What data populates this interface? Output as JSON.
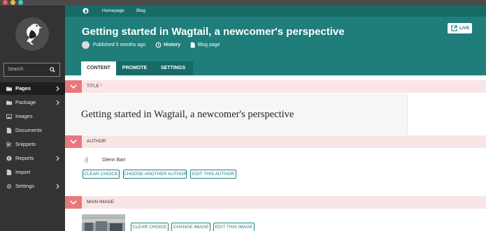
{
  "window": {
    "dots": [
      "#f25a5a",
      "#f5b640",
      "#3ec8c0"
    ]
  },
  "sidebar": {
    "search_placeholder": "Search",
    "items": [
      {
        "label": "Pages",
        "icon": "folder-icon",
        "active": true,
        "chevron": true
      },
      {
        "label": "Package",
        "icon": "package-icon",
        "active": false,
        "chevron": true
      },
      {
        "label": "Images",
        "icon": "image-icon",
        "active": false,
        "chevron": false
      },
      {
        "label": "Documents",
        "icon": "document-icon",
        "active": false,
        "chevron": false
      },
      {
        "label": "Snippets",
        "icon": "snippet-icon",
        "active": false,
        "chevron": false
      },
      {
        "label": "Reports",
        "icon": "report-icon",
        "active": false,
        "chevron": true
      },
      {
        "label": "Import",
        "icon": "import-icon",
        "active": false,
        "chevron": false
      },
      {
        "label": "Settings",
        "icon": "cog-icon",
        "active": false,
        "chevron": true
      }
    ]
  },
  "header": {
    "breadcrumb": [
      "Homepage",
      "Blog"
    ],
    "title": "Getting started in Wagtail, a newcomer's perspective",
    "live_label": "LIVE",
    "published": "Published 5 months ago",
    "history": "History",
    "page_type": "Blog page",
    "tabs": [
      {
        "label": "CONTENT",
        "active": true
      },
      {
        "label": "PROMOTE",
        "active": false
      },
      {
        "label": "SETTINGS",
        "active": false
      }
    ]
  },
  "content": {
    "title_section": {
      "label": "TITLE",
      "required_mark": "*",
      "value": "Getting started in Wagtail, a newcomer's perspective"
    },
    "author_section": {
      "label": "AUTHOR",
      "author_name": "Glenn Barr",
      "buttons": [
        "CLEAR CHOICE",
        "CHOOSE ANOTHER AUTHOR",
        "EDIT THIS AUTHOR"
      ]
    },
    "image_section": {
      "label": "MAIN IMAGE",
      "buttons": [
        "CLEAR CHOICE",
        "CHANGE IMAGE",
        "EDIT THIS IMAGE"
      ]
    }
  },
  "colors": {
    "brand_teal": "#1f7e7a",
    "sidebar": "#333333",
    "section_accent": "#e9787d",
    "section_bg": "#fae5e6"
  }
}
